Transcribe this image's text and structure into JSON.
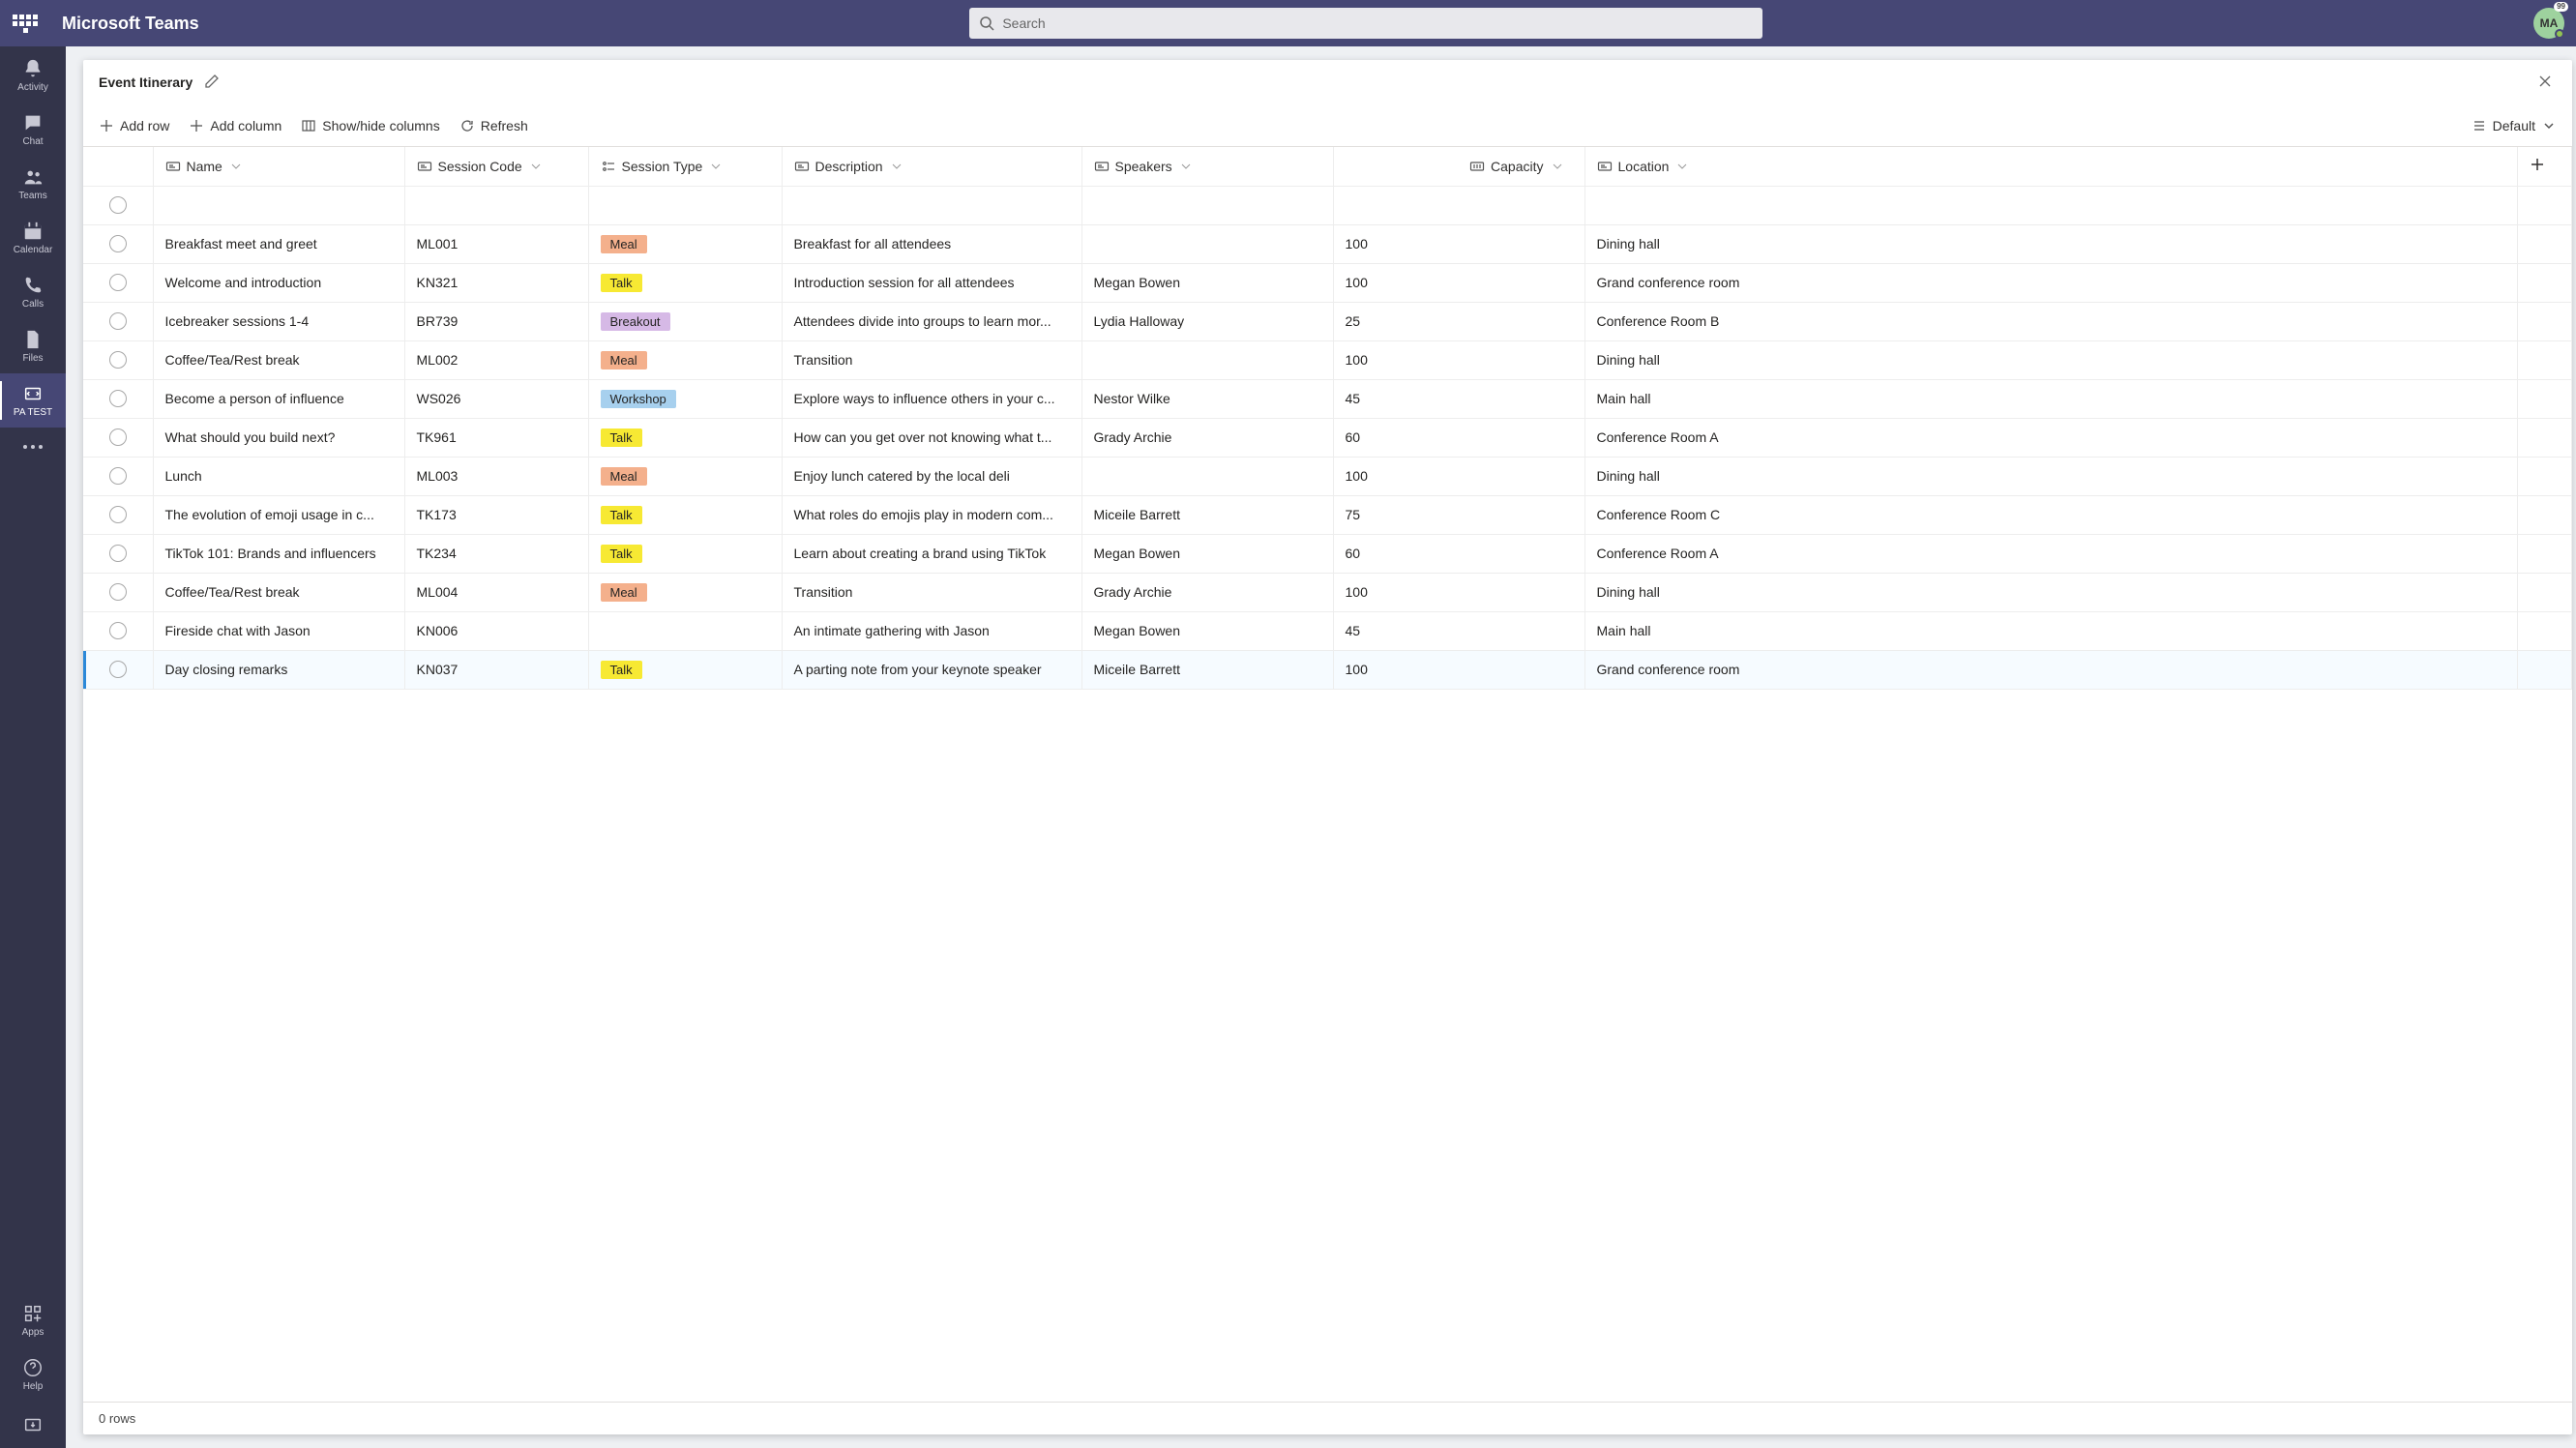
{
  "header": {
    "brand": "Microsoft Teams",
    "search_placeholder": "Search",
    "avatar_initials": "MA",
    "avatar_badge": "99"
  },
  "rail": {
    "items": [
      {
        "id": "activity",
        "label": "Activity"
      },
      {
        "id": "chat",
        "label": "Chat"
      },
      {
        "id": "teams",
        "label": "Teams"
      },
      {
        "id": "calendar",
        "label": "Calendar"
      },
      {
        "id": "calls",
        "label": "Calls"
      },
      {
        "id": "files",
        "label": "Files"
      },
      {
        "id": "patest",
        "label": "PA TEST"
      }
    ],
    "bottom": [
      {
        "id": "apps",
        "label": "Apps"
      },
      {
        "id": "help",
        "label": "Help"
      }
    ]
  },
  "panel": {
    "title": "Event Itinerary",
    "toolbar": {
      "add_row": "Add row",
      "add_column": "Add column",
      "show_hide": "Show/hide columns",
      "refresh": "Refresh",
      "view_label": "Default"
    },
    "columns": {
      "name": "Name",
      "code": "Session Code",
      "type": "Session Type",
      "desc": "Description",
      "speakers": "Speakers",
      "capacity": "Capacity",
      "location": "Location"
    },
    "rows": [
      {
        "name": "Breakfast meet and greet",
        "code": "ML001",
        "type": "Meal",
        "desc": "Breakfast for all attendees",
        "speakers": "",
        "capacity": "100",
        "location": "Dining hall"
      },
      {
        "name": "Welcome and introduction",
        "code": "KN321",
        "type": "Talk",
        "desc": "Introduction session for all attendees",
        "speakers": "Megan Bowen",
        "capacity": "100",
        "location": "Grand conference room"
      },
      {
        "name": "Icebreaker sessions 1-4",
        "code": "BR739",
        "type": "Breakout",
        "desc": "Attendees divide into groups to learn mor...",
        "speakers": "Lydia Halloway",
        "capacity": "25",
        "location": "Conference Room B"
      },
      {
        "name": "Coffee/Tea/Rest break",
        "code": "ML002",
        "type": "Meal",
        "desc": "Transition",
        "speakers": "",
        "capacity": "100",
        "location": "Dining hall"
      },
      {
        "name": "Become a person of influence",
        "code": "WS026",
        "type": "Workshop",
        "desc": "Explore ways to influence others in your c...",
        "speakers": "Nestor Wilke",
        "capacity": "45",
        "location": "Main hall"
      },
      {
        "name": "What should you build next?",
        "code": "TK961",
        "type": "Talk",
        "desc": "How can you get over not knowing what t...",
        "speakers": "Grady Archie",
        "capacity": "60",
        "location": "Conference Room A"
      },
      {
        "name": "Lunch",
        "code": "ML003",
        "type": "Meal",
        "desc": "Enjoy lunch catered by the local deli",
        "speakers": "",
        "capacity": "100",
        "location": "Dining hall"
      },
      {
        "name": "The evolution of emoji usage in c...",
        "code": "TK173",
        "type": "Talk",
        "desc": "What roles do emojis play in modern com...",
        "speakers": "Miceile Barrett",
        "capacity": "75",
        "location": "Conference Room C"
      },
      {
        "name": "TikTok 101: Brands and influencers",
        "code": "TK234",
        "type": "Talk",
        "desc": "Learn about creating a brand using TikTok",
        "speakers": "Megan Bowen",
        "capacity": "60",
        "location": "Conference Room A"
      },
      {
        "name": "Coffee/Tea/Rest break",
        "code": "ML004",
        "type": "Meal",
        "desc": "Transition",
        "speakers": "Grady Archie",
        "capacity": "100",
        "location": "Dining hall"
      },
      {
        "name": "Fireside chat with Jason",
        "code": "KN006",
        "type": "",
        "desc": "An intimate gathering with Jason",
        "speakers": "Megan Bowen",
        "capacity": "45",
        "location": "Main hall"
      },
      {
        "name": "Day closing remarks",
        "code": "KN037",
        "type": "Talk",
        "desc": "A parting note from your keynote speaker",
        "speakers": "Miceile Barrett",
        "capacity": "100",
        "location": "Grand conference room"
      }
    ],
    "selected_index": 11,
    "status": "0 rows"
  }
}
